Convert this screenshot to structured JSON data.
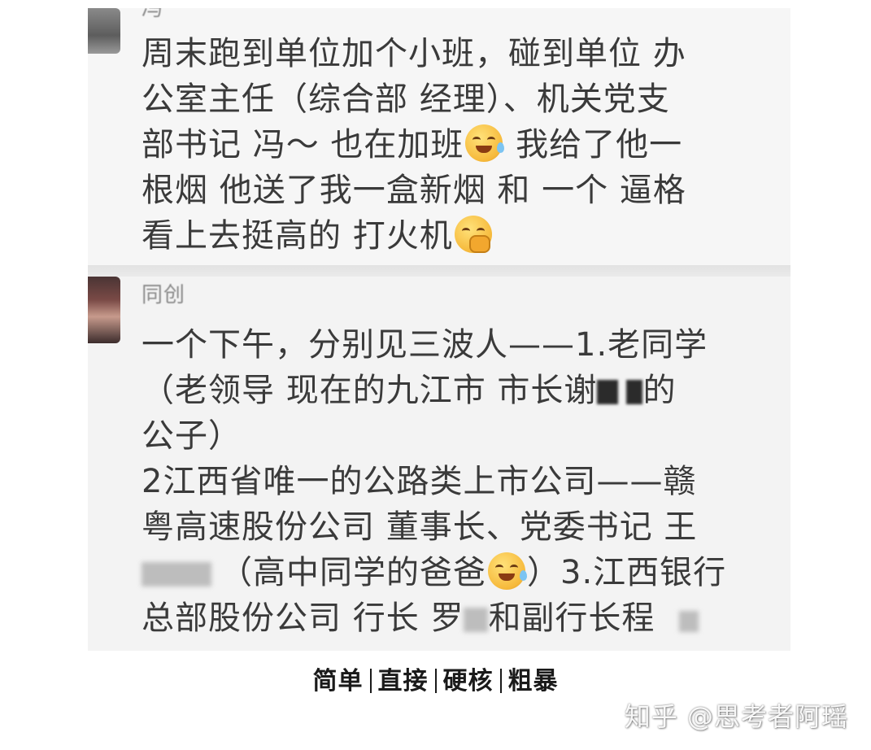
{
  "post_1": {
    "nickname": "冯",
    "lines": [
      "周末跑到单位加个小班，碰到单位 办",
      "公室主任（综合部 经理）、机关党支",
      "部书记 冯～ 也在加班",
      "我给了他一",
      "根烟  他送了我一盒新烟 和 一个 逼格",
      "看上去挺高的 打火机"
    ],
    "emojis": [
      "laugh-cry-emoji",
      "yawn-emoji"
    ]
  },
  "post_2": {
    "nickname": "同创",
    "lines": [
      "一个下午，分别见三波人——1.老同学",
      "（老领导 现在的九江市 市长谢",
      "的",
      "公子）",
      "2江西省唯一的公路类上市公司——赣",
      "粤高速股份公司 董事长、党委书记 王",
      "（高中同学的爸爸",
      "）3.江西银行",
      "总部股份公司 行长 罗",
      "和副行长程"
    ],
    "emojis": [
      "laugh-cry-emoji"
    ]
  },
  "caption": {
    "parts": [
      "简单",
      "直接",
      "硬核",
      "粗暴"
    ]
  },
  "watermark": {
    "text": "知乎 @思考者阿瑶"
  },
  "colors": {
    "post_background": "#f6f6f6",
    "text": "#3a3a3a",
    "nickname": "#8a8a8a",
    "caption": "#1a1a1a"
  }
}
